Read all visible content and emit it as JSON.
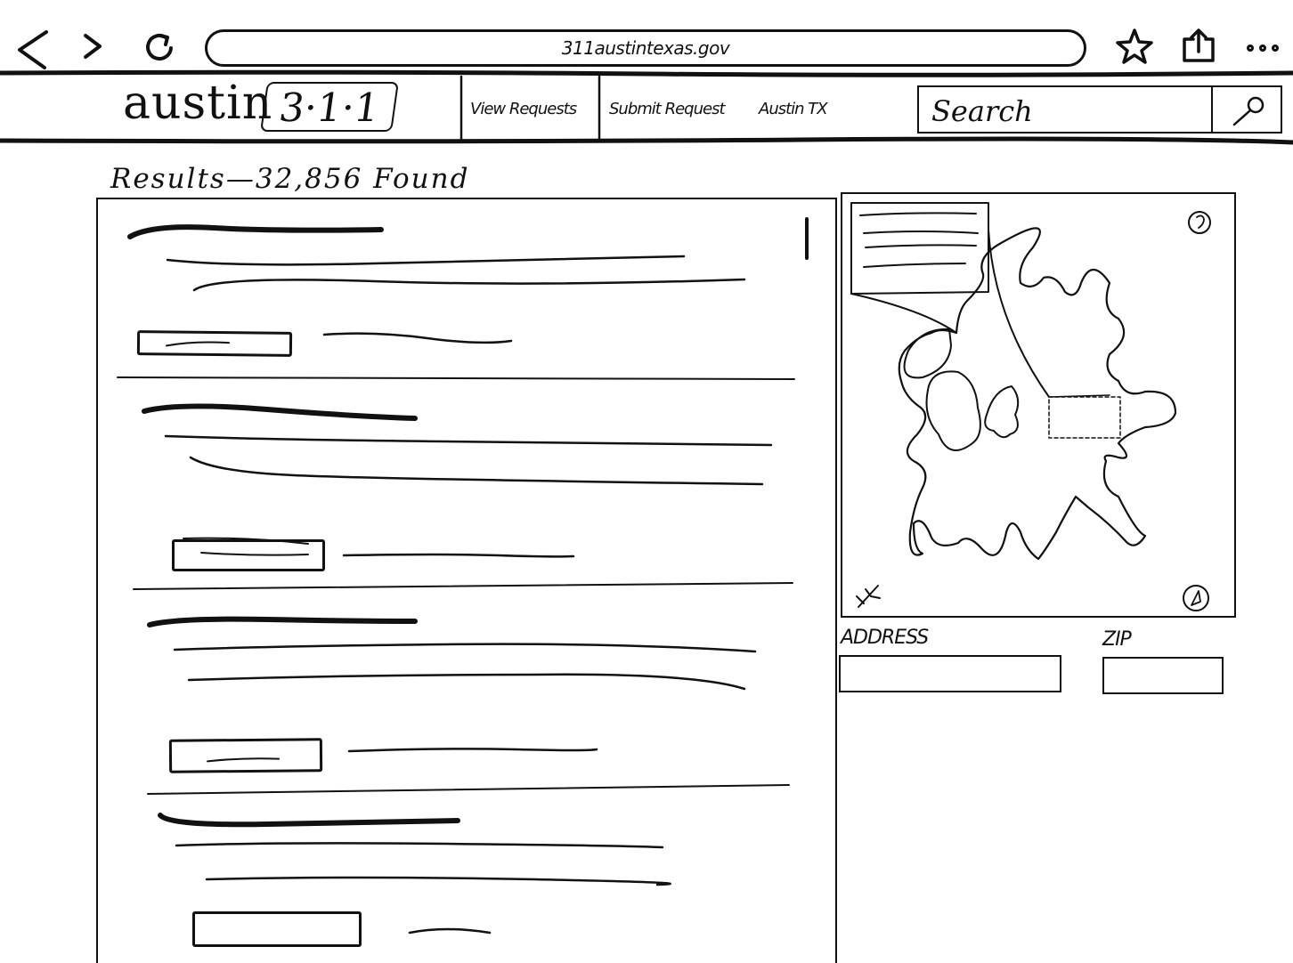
{
  "browser": {
    "url": "311austintexas.gov",
    "icons": [
      "back-arrow-icon",
      "forward-arrow-icon",
      "reload-icon",
      "star-icon",
      "share-icon",
      "more-icon"
    ]
  },
  "header": {
    "logo_text": "austin",
    "logo_badge": "3·1·1",
    "nav": [
      {
        "label": "View Requests"
      },
      {
        "label": "Submit Request"
      },
      {
        "label": "Austin TX"
      }
    ],
    "search_placeholder": "Search"
  },
  "results": {
    "heading": "Results—32,856 Found",
    "items_note": "four result cards rendered as sketch placeholder lines"
  },
  "map": {
    "icons": [
      "map-legend-popover",
      "info-icon",
      "collapse-icon",
      "locate-icon"
    ]
  },
  "form": {
    "address_label": "ADDRESS",
    "zip_label": "ZIP"
  }
}
